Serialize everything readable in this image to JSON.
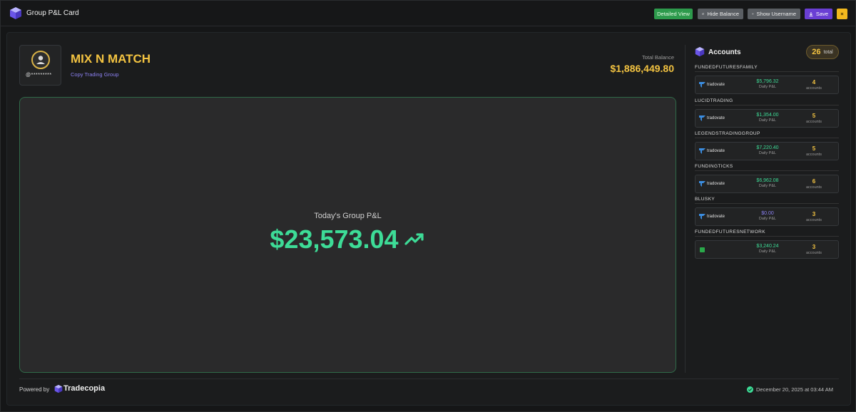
{
  "window": {
    "title": "Group P&L Card"
  },
  "toolbar": {
    "detailed_view_label": "Detailed View",
    "hide_balance_label": "Hide Balance",
    "show_username_label": "Show Username",
    "save_label": "Save",
    "close_label": "×"
  },
  "group": {
    "name": "MIX N MATCH",
    "subtitle": "Copy Trading Group",
    "username": "@*********",
    "total_balance_label": "Total Balance",
    "total_balance": "$1,886,449.80"
  },
  "pnl": {
    "label": "Today's Group P&L",
    "value": "$23,573.04"
  },
  "accounts": {
    "title": "Accounts",
    "total_count": "26",
    "total_label": "total",
    "groups": [
      {
        "name": "FUNDEDFUTURESFAMILY",
        "broker": "tradovate",
        "daily_pnl": "$5,796.32",
        "daily_label": "Daily P&L",
        "count": "4",
        "count_label": "accounts"
      },
      {
        "name": "LUCIDTRADING",
        "broker": "tradovate",
        "daily_pnl": "$1,354.00",
        "daily_label": "Daily P&L",
        "count": "5",
        "count_label": "accounts"
      },
      {
        "name": "LEGENDSTRADINGGROUP",
        "broker": "tradovate",
        "daily_pnl": "$7,220.40",
        "daily_label": "Daily P&L",
        "count": "5",
        "count_label": "accounts"
      },
      {
        "name": "FUNDINGTICKS",
        "broker": "tradovate",
        "daily_pnl": "$6,962.08",
        "daily_label": "Daily P&L",
        "count": "6",
        "count_label": "accounts"
      },
      {
        "name": "BLUSKY",
        "broker": "tradovate",
        "daily_pnl": "$0.00",
        "daily_label": "Daily P&L",
        "count": "3",
        "count_label": "accounts"
      },
      {
        "name": "FUNDEDFUTURESNETWORK",
        "broker": "",
        "daily_pnl": "$3,240.24",
        "daily_label": "Daily P&L",
        "count": "3",
        "count_label": "accounts"
      }
    ]
  },
  "footer": {
    "powered_by": "Powered by",
    "brand": "Tradecopia",
    "timestamp": "December 20, 2025 at 03:44 AM"
  },
  "colors": {
    "accent_gold": "#f3c341",
    "profit_green": "#3ddc97",
    "purple": "#8b80f0"
  }
}
